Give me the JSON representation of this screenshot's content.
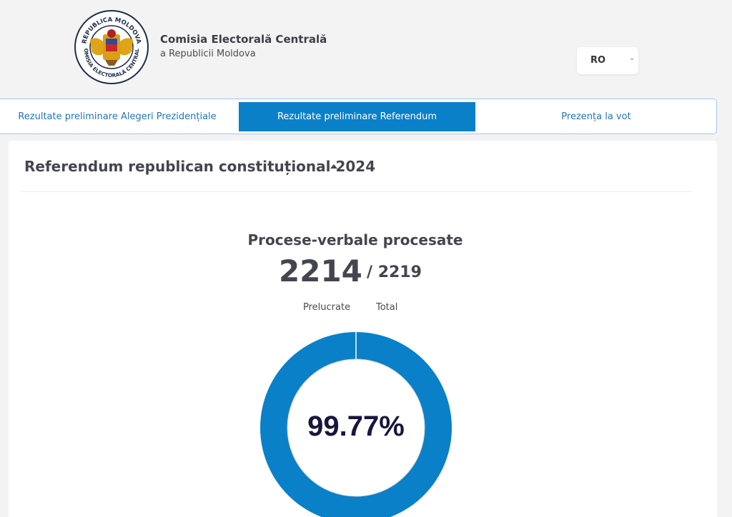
{
  "header": {
    "org_title": "Comisia Electorală Centrală",
    "org_subtitle": "a Republicii Moldova",
    "logo": {
      "ring_top": "REPUBLICA MOLDOVA",
      "ring_bottom": "COMISIA ELECTORALĂ CENTRALĂ"
    },
    "language": {
      "selected": "RO"
    }
  },
  "tabs": [
    {
      "label": "Rezultate preliminare Alegeri Prezidențiale",
      "active": false
    },
    {
      "label": "Rezultate preliminare Referendum",
      "active": true
    },
    {
      "label": "Prezența la vot",
      "active": false
    }
  ],
  "main": {
    "section_title": "Referendum republican constituțional 2024",
    "heading": "Procese-verbale procesate",
    "processed": "2214",
    "total": "/ 2219",
    "processed_label": "Prelucrate",
    "total_label": "Total",
    "percent": "99.77%"
  },
  "chart_data": {
    "type": "pie",
    "values": [
      2214,
      5
    ],
    "labels": [
      "Prelucrate",
      ""
    ],
    "colors": [
      "#0a80c9",
      "#ffffff"
    ]
  },
  "colors": {
    "accent": "#0a80c9",
    "text": "#45454f",
    "background": "#f3f3f3"
  }
}
